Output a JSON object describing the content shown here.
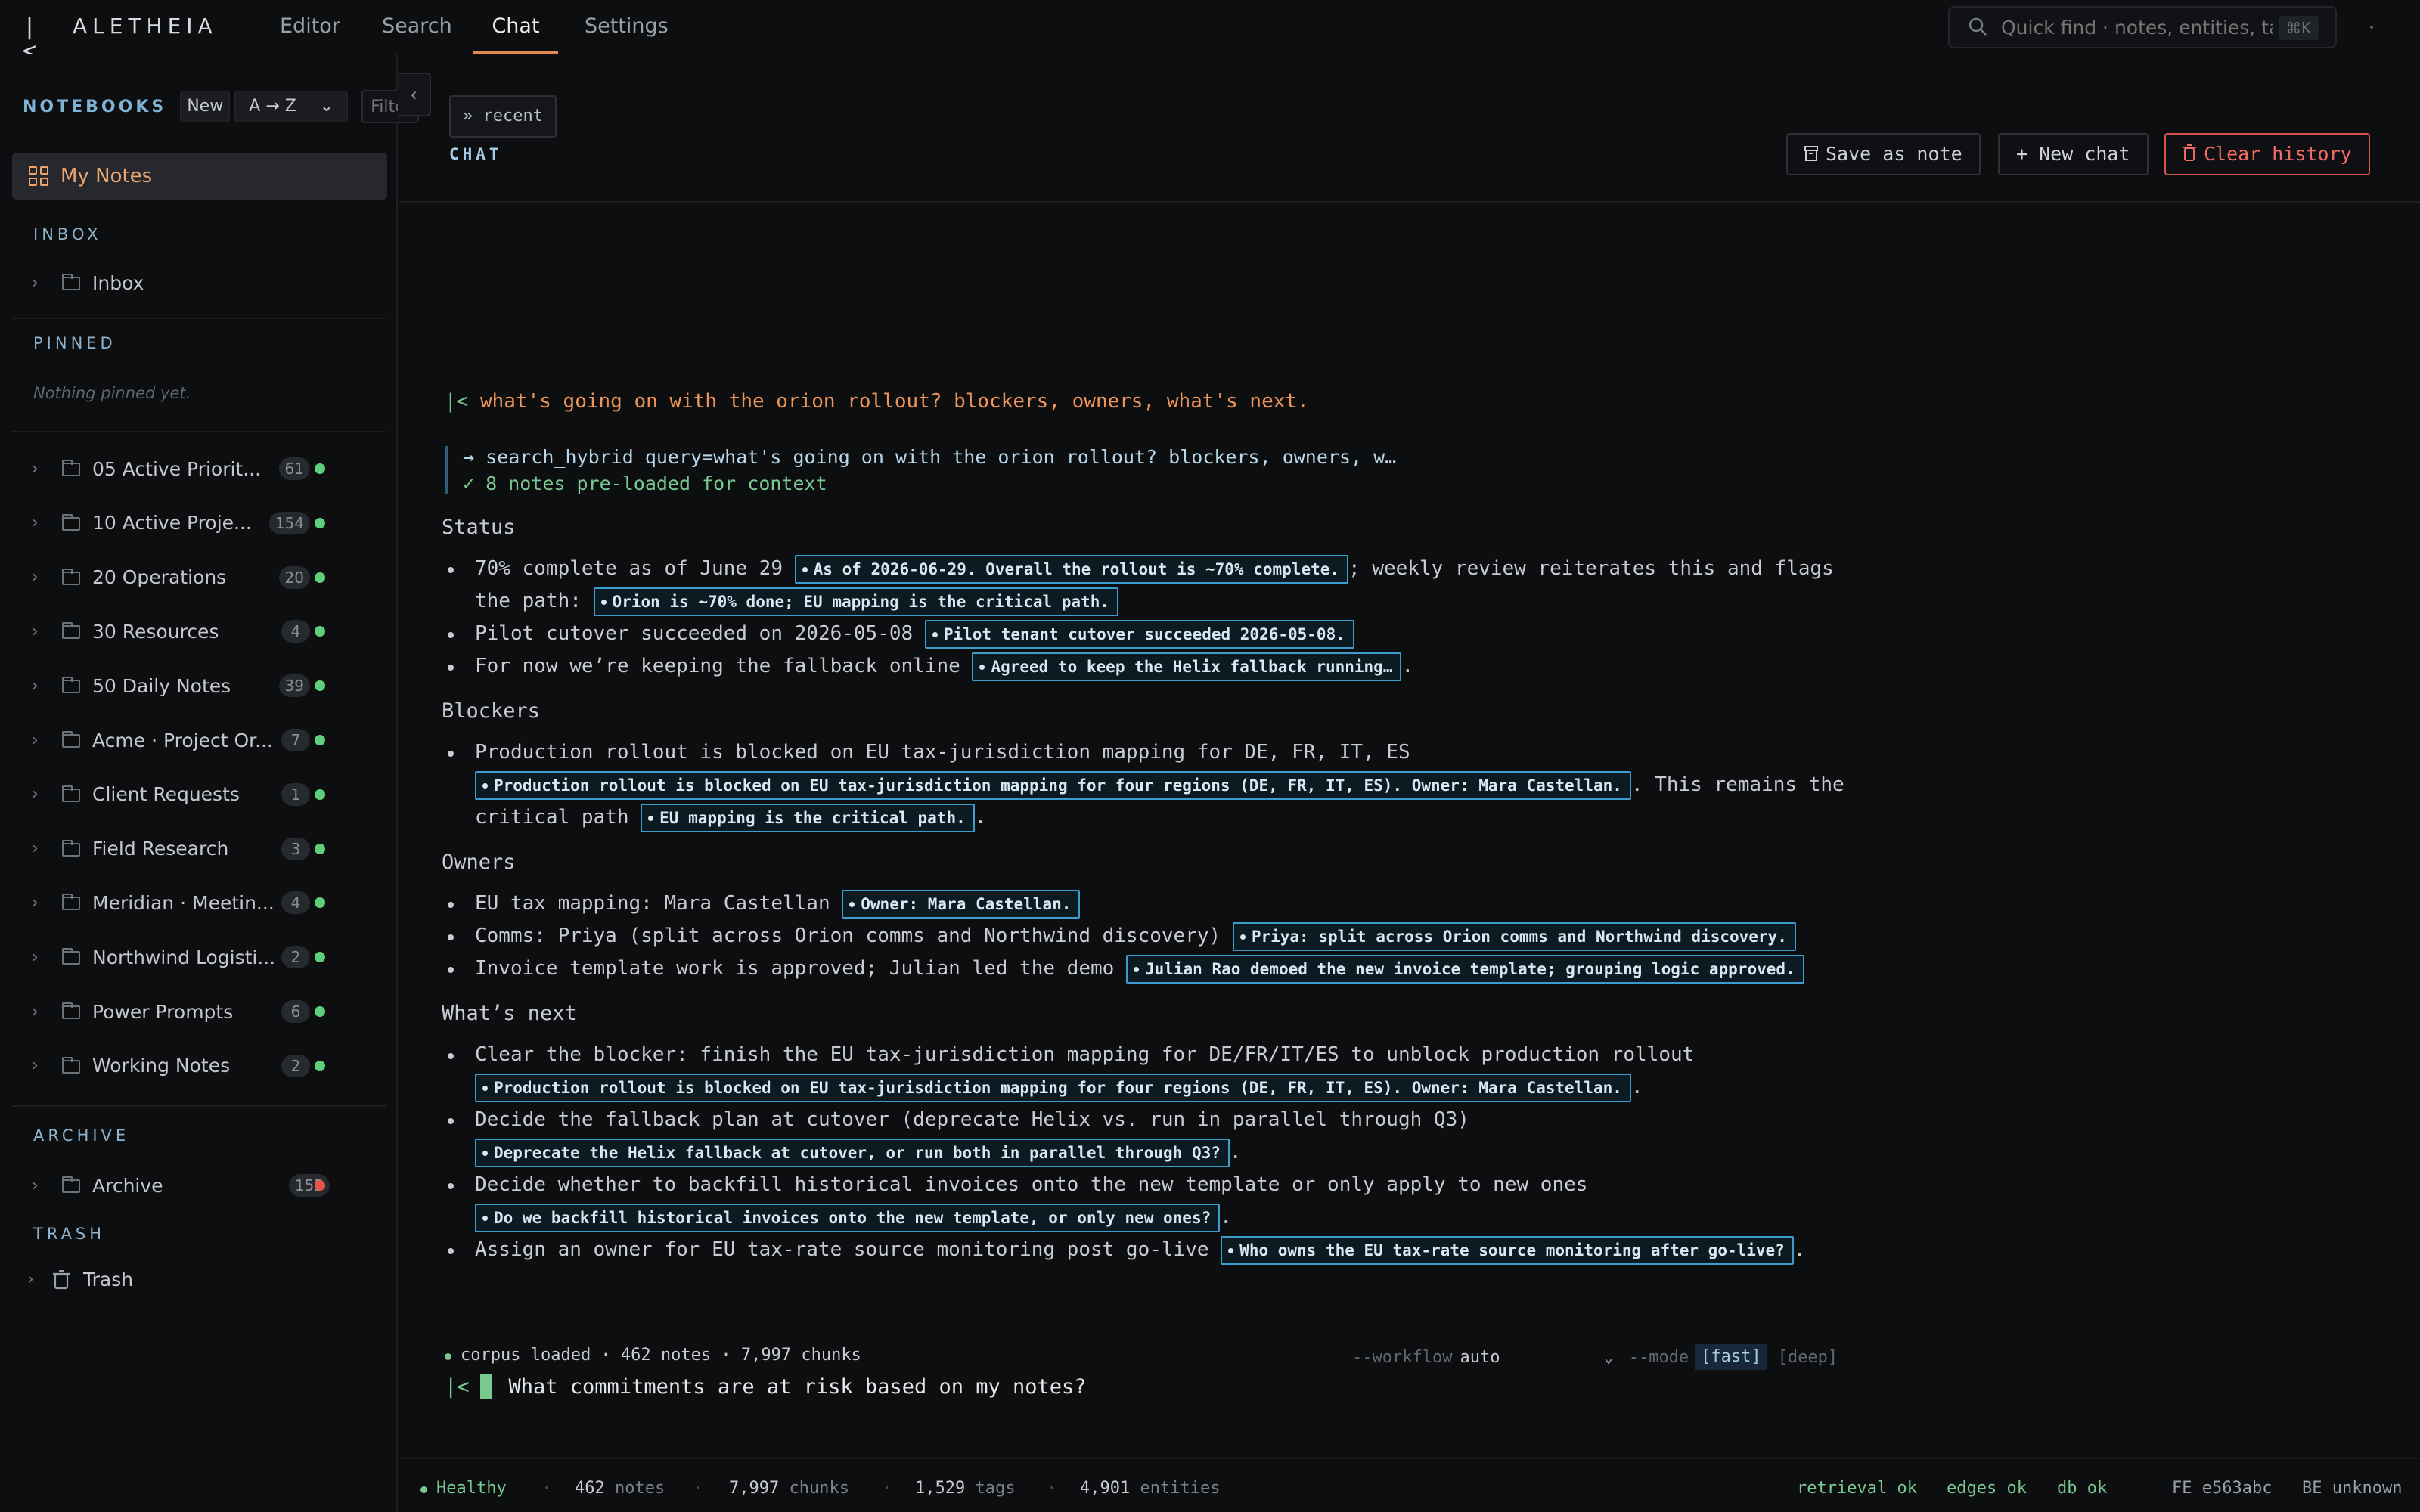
{
  "app": {
    "title": "ALETHEIA",
    "logo_mark": "|<"
  },
  "nav": {
    "tabs": [
      "Editor",
      "Search",
      "Chat",
      "Settings"
    ],
    "active": "Chat"
  },
  "quick_find": {
    "placeholder": "Quick find · notes, entities, tags",
    "shortcut": "⌘K"
  },
  "sidebar": {
    "title": "NOTEBOOKS",
    "new_label": "New",
    "sort_value": "A → Z",
    "filter_placeholder": "Filter",
    "my_notes": "My Notes",
    "inbox_label": "INBOX",
    "inbox_item": "Inbox",
    "pinned_label": "PINNED",
    "pinned_empty": "Nothing pinned yet.",
    "notebooks": [
      {
        "name": "05 Active Priorit...",
        "count": "61",
        "status": "ok"
      },
      {
        "name": "10 Active Proje...",
        "count": "154",
        "status": "ok"
      },
      {
        "name": "20 Operations",
        "count": "20",
        "status": "ok"
      },
      {
        "name": "30 Resources",
        "count": "4",
        "status": "ok"
      },
      {
        "name": "50 Daily Notes",
        "count": "39",
        "status": "ok"
      },
      {
        "name": "Acme · Project Or...",
        "count": "7",
        "status": "ok"
      },
      {
        "name": "Client Requests",
        "count": "1",
        "status": "ok"
      },
      {
        "name": "Field Research",
        "count": "3",
        "status": "ok"
      },
      {
        "name": "Meridian · Meetin...",
        "count": "4",
        "status": "ok"
      },
      {
        "name": "Northwind Logisti...",
        "count": "2",
        "status": "ok"
      },
      {
        "name": "Power Prompts",
        "count": "6",
        "status": "ok"
      },
      {
        "name": "Working Notes",
        "count": "2",
        "status": "ok"
      }
    ],
    "archive_label": "ARCHIVE",
    "archive_item": {
      "name": "Archive",
      "count": "155"
    },
    "trash_label": "TRASH",
    "trash_item": "Trash",
    "colors": {
      "ok": "#5fcf7a",
      "error": "#e5534b"
    }
  },
  "chat": {
    "recent_label": "» recent",
    "section_label": "CHAT",
    "save_label": "Save as note",
    "new_label": "+ New chat",
    "clear_label": "Clear history",
    "question_prefix": "|<",
    "question": "what's going on with the orion rollout? blockers, owners, what's next.",
    "tool_call": "→ search_hybrid query=what's going on with the orion rollout? blockers, owners, w…",
    "tool_result": "✓ 8 notes pre-loaded for context",
    "status_heading": "Status",
    "status_1_text": "70% complete as of June 29",
    "status_1_cite": "As of 2026-06-29. Overall the rollout is ~70% complete.",
    "status_1_text2": "; weekly review reiterates this and flags",
    "status_1_text3": "the path:",
    "status_1_cite2": "Orion is ~70% done; EU mapping is the critical path.",
    "status_2_text": "Pilot cutover succeeded on 2026-05-08",
    "status_2_cite": "Pilot tenant cutover succeeded 2026-05-08.",
    "status_3_text": "For now we’re keeping the fallback online",
    "status_3_cite": "Agreed to keep the Helix fallback running…",
    "blockers_heading": "Blockers",
    "blocker_1_text": "Production rollout is blocked on EU tax-jurisdiction mapping for DE, FR, IT, ES",
    "blocker_1_cite": "Production rollout is blocked on EU tax-jurisdiction mapping for four regions (DE, FR, IT, ES). Owner: Mara Castellan.",
    "blocker_1_text2": ". This remains the",
    "blocker_1_text3": "critical path",
    "blocker_1_cite2": "EU mapping is the critical path.",
    "owners_heading": "Owners",
    "owner_1_text": "EU tax mapping: Mara Castellan",
    "owner_1_cite": "Owner: Mara Castellan.",
    "owner_2_text": "Comms: Priya (split across Orion comms and Northwind discovery)",
    "owner_2_cite": "Priya: split across Orion comms and Northwind discovery.",
    "owner_3_text": "Invoice template work is approved; Julian led the demo",
    "owner_3_cite": "Julian Rao demoed the new invoice template; grouping logic approved.",
    "next_heading": "What’s next",
    "next_1_text": "Clear the blocker: finish the EU tax-jurisdiction mapping for DE/FR/IT/ES to unblock production rollout",
    "next_1_cite": "Production rollout is blocked on EU tax-jurisdiction mapping for four regions (DE, FR, IT, ES). Owner: Mara Castellan.",
    "next_2_text": "Decide the fallback plan at cutover (deprecate Helix vs. run in parallel through Q3)",
    "next_2_cite": "Deprecate the Helix fallback at cutover, or run both in parallel through Q3?",
    "next_3_text": "Decide whether to backfill historical invoices onto the new template or only apply to new ones",
    "next_3_cite": "Do we backfill historical invoices onto the new template, or only new ones?",
    "next_4_text": "Assign an owner for EU tax-rate source monitoring post go-live",
    "next_4_cite": "Who owns the EU tax-rate source monitoring after go-live?",
    "period": "."
  },
  "composer": {
    "corpus": "corpus loaded · 462 notes · 7,997 chunks",
    "workflow_flag": "--workflow",
    "workflow_value": "auto",
    "mode_flag": "--mode",
    "mode_fast": "[fast]",
    "mode_deep": "[deep]",
    "prompt_prefix": "|<",
    "input_value": "What commitments are at risk based on my notes?"
  },
  "statusbar": {
    "health": "Healthy",
    "notes_n": "462",
    "notes_l": "notes",
    "chunks_n": "7,997",
    "chunks_l": "chunks",
    "tags_n": "1,529",
    "tags_l": "tags",
    "entities_n": "4,901",
    "entities_l": "entities",
    "retrieval": "retrieval ok",
    "edges": "edges ok",
    "db": "db ok",
    "fe": "FE e563abc",
    "be": "BE unknown"
  }
}
